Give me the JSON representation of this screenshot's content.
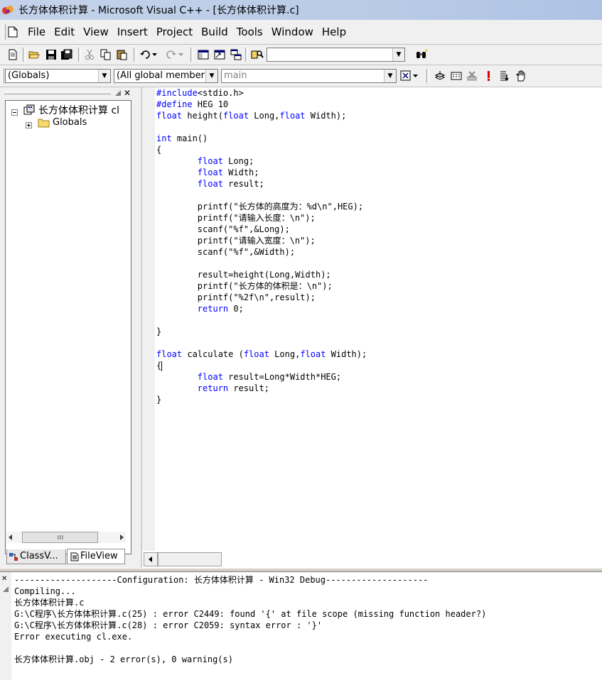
{
  "window": {
    "title": "长方体体积计算 - Microsoft Visual C++ - [长方体体积计算.c]"
  },
  "menu": [
    "File",
    "Edit",
    "View",
    "Insert",
    "Project",
    "Build",
    "Tools",
    "Window",
    "Help"
  ],
  "toolbar": {
    "find_value": ""
  },
  "wizardbar": {
    "class_combo": "(Globals)",
    "filter_combo": "(All global member",
    "member_combo": "main"
  },
  "workspace": {
    "project_node": "长方体体积计算 cl",
    "globals_node": "Globals",
    "tabs": [
      "ClassV...",
      "FileView"
    ]
  },
  "editor": {
    "lines": [
      [
        [
          "kw",
          "#include"
        ],
        [
          "t",
          "<stdio.h>"
        ]
      ],
      [
        [
          "kw",
          "#define"
        ],
        [
          "t",
          " HEG 10"
        ]
      ],
      [
        [
          "kw",
          "float"
        ],
        [
          "t",
          " height("
        ],
        [
          "kw",
          "float"
        ],
        [
          "t",
          " Long,"
        ],
        [
          "kw",
          "float"
        ],
        [
          "t",
          " Width);"
        ]
      ],
      [],
      [
        [
          "kw",
          "int"
        ],
        [
          "t",
          " main()"
        ]
      ],
      [
        [
          "t",
          "{"
        ]
      ],
      [
        [
          "t",
          "        "
        ],
        [
          "kw",
          "float"
        ],
        [
          "t",
          " Long;"
        ]
      ],
      [
        [
          "t",
          "        "
        ],
        [
          "kw",
          "float"
        ],
        [
          "t",
          " Width;"
        ]
      ],
      [
        [
          "t",
          "        "
        ],
        [
          "kw",
          "float"
        ],
        [
          "t",
          " result;"
        ]
      ],
      [],
      [
        [
          "t",
          "        printf(\"长方体的高度为：%d\\n\",HEG);"
        ]
      ],
      [
        [
          "t",
          "        printf(\"请输入长度：\\n\");"
        ]
      ],
      [
        [
          "t",
          "        scanf(\"%f\",&Long);"
        ]
      ],
      [
        [
          "t",
          "        printf(\"请输入宽度：\\n\");"
        ]
      ],
      [
        [
          "t",
          "        scanf(\"%f\",&Width);"
        ]
      ],
      [],
      [
        [
          "t",
          "        result=height(Long,Width);"
        ]
      ],
      [
        [
          "t",
          "        printf(\"长方体的体积是：\\n\");"
        ]
      ],
      [
        [
          "t",
          "        printf(\"%2f\\n\",result);"
        ]
      ],
      [
        [
          "t",
          "        "
        ],
        [
          "kw",
          "return"
        ],
        [
          "t",
          " 0;"
        ]
      ],
      [],
      [
        [
          "t",
          "}"
        ]
      ],
      [],
      [
        [
          "kw",
          "float"
        ],
        [
          "t",
          " calculate ("
        ],
        [
          "kw",
          "float"
        ],
        [
          "t",
          " Long,"
        ],
        [
          "kw",
          "float"
        ],
        [
          "t",
          " Width);"
        ]
      ],
      [
        [
          "t",
          "{"
        ],
        [
          "caret",
          ""
        ]
      ],
      [
        [
          "t",
          "        "
        ],
        [
          "kw",
          "float"
        ],
        [
          "t",
          " result=Long*Width*HEG;"
        ]
      ],
      [
        [
          "t",
          "        "
        ],
        [
          "kw",
          "return"
        ],
        [
          "t",
          " result;"
        ]
      ],
      [
        [
          "t",
          "}"
        ]
      ]
    ]
  },
  "output": {
    "lines": [
      "--------------------Configuration: 长方体体积计算 - Win32 Debug--------------------",
      "Compiling...",
      "长方体体积计算.c",
      "G:\\C程序\\长方体体积计算.c(25) : error C2449: found '{' at file scope (missing function header?)",
      "G:\\C程序\\长方体体积计算.c(28) : error C2059: syntax error : '}'",
      "Error executing cl.exe.",
      "",
      "长方体体积计算.obj - 2 error(s), 0 warning(s)"
    ]
  }
}
